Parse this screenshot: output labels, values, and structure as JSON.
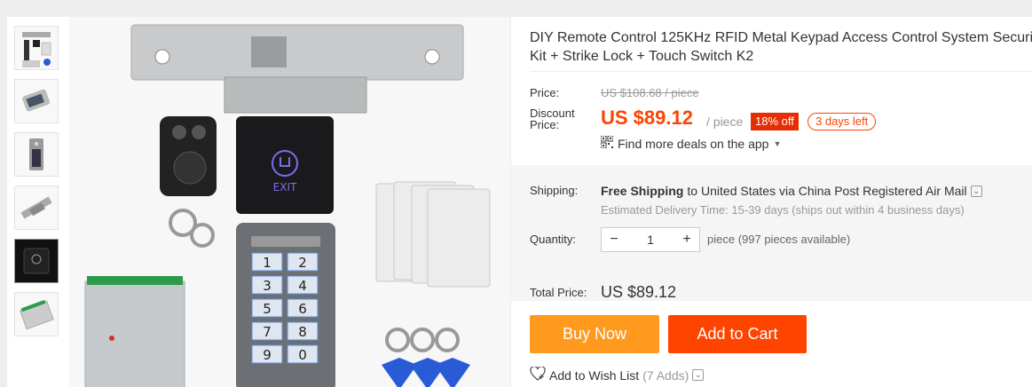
{
  "product": {
    "title_line1": "DIY Remote Control 125KHz RFID Metal Keypad Access Control System Securi",
    "title_line2": "Kit + Strike Lock + Touch Switch K2"
  },
  "price": {
    "price_label": "Price:",
    "original": "US $108.68 / piece",
    "discount_label_1": "Discount",
    "discount_label_2": "Price:",
    "current": "US $89.12",
    "per": "/ piece",
    "off": "18% off",
    "days_left": "3 days left",
    "deals_text": "Find more deals on the app"
  },
  "shipping": {
    "label": "Shipping:",
    "free": "Free Shipping",
    "to": "to",
    "rest": "United States via China Post Registered Air Mail",
    "delivery": "Estimated Delivery Time: 15-39 days (ships out within 4 business days)"
  },
  "quantity": {
    "label": "Quantity:",
    "minus": "−",
    "value": "1",
    "plus": "+",
    "available": "piece (997 pieces available)"
  },
  "total": {
    "label": "Total Price:",
    "value": "US $89.12"
  },
  "actions": {
    "buy_now": "Buy Now",
    "add_to_cart": "Add to Cart",
    "wish": "Add to Wish List",
    "wish_count": "(7 Adds)"
  },
  "image": {
    "exit_text": "EXIT",
    "keys": [
      "1",
      "2",
      "3",
      "4",
      "5",
      "6",
      "7",
      "8",
      "9",
      "0"
    ],
    "thumb_icons": [
      "kit-thumb",
      "card-reader-thumb",
      "keypad-thumb",
      "strike-lock-thumb",
      "exit-button-thumb",
      "power-supply-thumb"
    ]
  },
  "colors": {
    "accent": "#ff4400",
    "buy_now": "#ff9a1f",
    "badge_red": "#e62e04"
  }
}
